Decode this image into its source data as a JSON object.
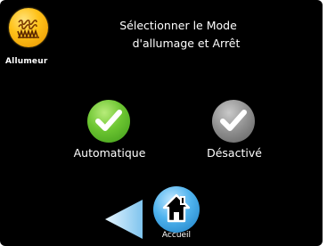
{
  "app": {
    "logo_label": "Allumeur",
    "logo_icon": "heating-coil-icon"
  },
  "header": {
    "title_line1": "Sélectionner le Mode",
    "title_line2": "d'allumage et Arrêt"
  },
  "modes": [
    {
      "label": "Automatique",
      "icon": "check-icon",
      "color": "#6cc531",
      "state": "active"
    },
    {
      "label": "Désactivé",
      "icon": "check-icon",
      "color": "#8e8e8e",
      "state": "inactive"
    }
  ],
  "navigation": {
    "back_icon": "back-arrow-icon",
    "home_icon": "home-icon",
    "home_label": "Accueil"
  },
  "colors": {
    "background": "#000000",
    "logo": "#ffc21a",
    "automatic": "#6cc531",
    "disabled": "#8e8e8e",
    "home": "#4fb3ee",
    "back_arrow": "#a8d8f8"
  }
}
